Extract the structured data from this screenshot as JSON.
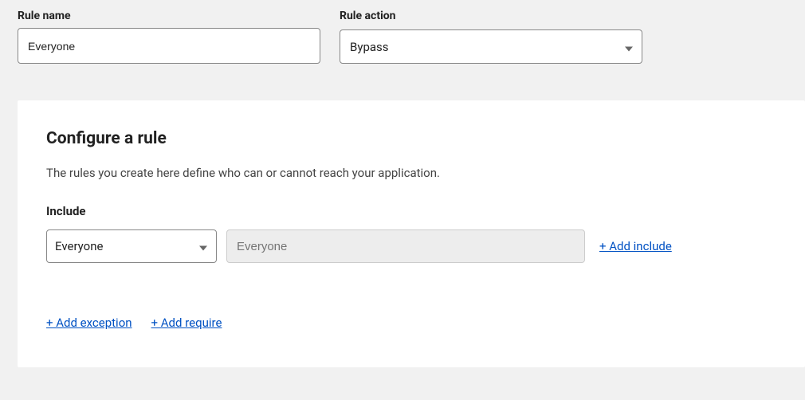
{
  "topForm": {
    "ruleName": {
      "label": "Rule name",
      "value": "Everyone"
    },
    "ruleAction": {
      "label": "Rule action",
      "value": "Bypass"
    }
  },
  "card": {
    "title": "Configure a rule",
    "description": "The rules you create here define who can or cannot reach your application.",
    "include": {
      "label": "Include",
      "selectorValue": "Everyone",
      "valuePlaceholder": "Everyone",
      "addLabel": "+ Add include"
    },
    "actions": {
      "addException": "+ Add exception",
      "addRequire": "+ Add require"
    }
  }
}
